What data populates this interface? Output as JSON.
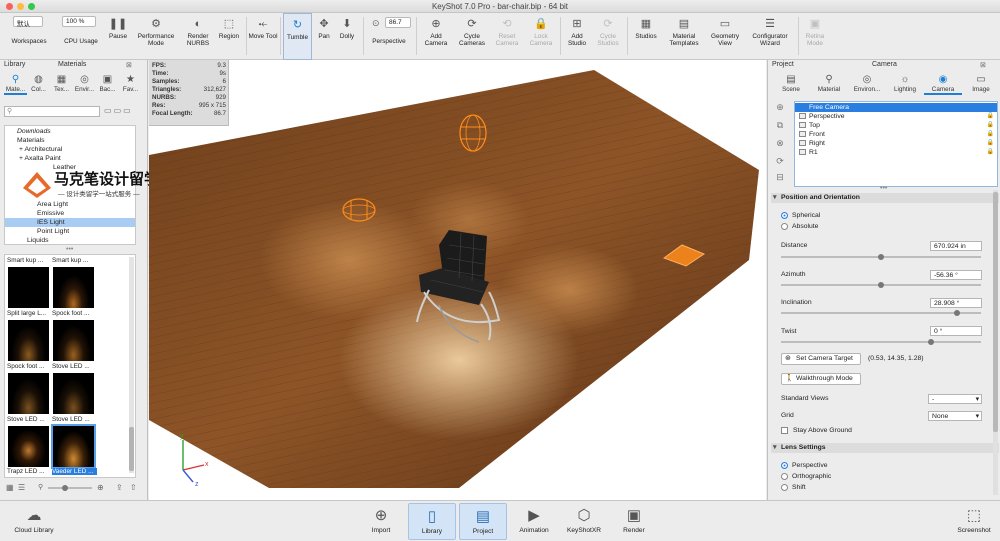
{
  "window": {
    "title": "KeyShot 7.0 Pro  -  bar-chair.bip  -  64 bit"
  },
  "toolbar": {
    "workspace_value": "默认",
    "workspaces_label": "Workspaces",
    "cpu_value": "100 %",
    "cpu_label": "CPU Usage",
    "pause_label": "Pause",
    "performance_label": "Performance Mode",
    "render_nurbs_label": "Render NURBS",
    "region_label": "Region",
    "move_tool_label": "Move Tool",
    "tumble_label": "Tumble",
    "pan_label": "Pan",
    "dolly_label": "Dolly",
    "perspective_value": "86.7",
    "perspective_label": "Perspective",
    "add_camera_label": "Add Camera",
    "cycle_cameras_label": "Cycle Cameras",
    "reset_camera_label": "Reset Camera",
    "lock_camera_label": "Lock Camera",
    "add_studio_label": "Add Studio",
    "cycle_studios_label": "Cycle Studios",
    "studios_label": "Studios",
    "material_templates_label": "Material Templates",
    "geometry_view_label": "Geometry View",
    "configurator_wizard_label": "Configurator Wizard",
    "retina_mode_label": "Retina Mode"
  },
  "left": {
    "library_label": "Library",
    "materials_label": "Materials",
    "tabs": [
      "Mate...",
      "Col...",
      "Tex...",
      "Envir...",
      "Bac...",
      "Fav..."
    ],
    "tree": [
      "Downloads",
      "Materials",
      "+ Architectural",
      "+ Axalta Paint",
      "Leather",
      "Area Light",
      "Emissive",
      "IES Light",
      "Point Light",
      "Liquids"
    ],
    "thumbs": [
      "Smart kup ...",
      "Smart kup ...",
      "Split large L...",
      "Spock foot ...",
      "Spock foot ...",
      "Stove LED ...",
      "Stove LED ...",
      "Stove LED ...",
      "Trapz LED ...",
      "Vaeder LED ..."
    ]
  },
  "watermark": {
    "line1": "马克笔设计留学",
    "line2": "— 设计类留学一站式服务 —"
  },
  "stats": [
    {
      "k": "FPS:",
      "v": "9.3"
    },
    {
      "k": "Time:",
      "v": "9s"
    },
    {
      "k": "Samples:",
      "v": "6"
    },
    {
      "k": "Triangles:",
      "v": "312,627"
    },
    {
      "k": "NURBS:",
      "v": "929"
    },
    {
      "k": "Res:",
      "v": "995 x 715"
    },
    {
      "k": "Focal Length:",
      "v": "86.7"
    }
  ],
  "right": {
    "project_label": "Project",
    "camera_header": "Camera",
    "tabs": [
      "Scene",
      "Material",
      "Environ...",
      "Lighting",
      "Camera",
      "Image"
    ],
    "cameras": [
      "Free Camera",
      "Perspective",
      "Top",
      "Front",
      "Right",
      "R1"
    ],
    "position_section": "Position and Orientation",
    "spherical": "Spherical",
    "absolute": "Absolute",
    "distance_label": "Distance",
    "distance_value": "670.924 in",
    "azimuth_label": "Azimuth",
    "azimuth_value": "-56.36 °",
    "inclination_label": "Inclination",
    "inclination_value": "28.908 °",
    "twist_label": "Twist",
    "twist_value": "0 °",
    "set_target_label": "Set Camera Target",
    "target_value": "(0.53, 14.35, 1.28)",
    "walkthrough_label": "Walkthrough Mode",
    "standard_views_label": "Standard Views",
    "standard_views_value": "-",
    "grid_label": "Grid",
    "grid_value": "None",
    "stay_above_label": "Stay Above Ground",
    "lens_section": "Lens Settings",
    "lens_perspective": "Perspective",
    "lens_ortho": "Orthographic",
    "lens_shift": "Shift",
    "slider_levels": {
      "distance": 0.5,
      "azimuth": 0.5,
      "inclination": 0.88,
      "twist": 0.75
    }
  },
  "bottom": {
    "cloud_label": "Cloud Library",
    "import_label": "Import",
    "library_label": "Library",
    "project_label": "Project",
    "animation_label": "Animation",
    "keyshotxr_label": "KeyShotXR",
    "render_label": "Render",
    "screenshot_label": "Screenshot"
  },
  "colors": {
    "accent": "#1d7fd6",
    "selection": "#2a7ee0",
    "floor": "#8a5326",
    "light": "#ff8c1a"
  }
}
